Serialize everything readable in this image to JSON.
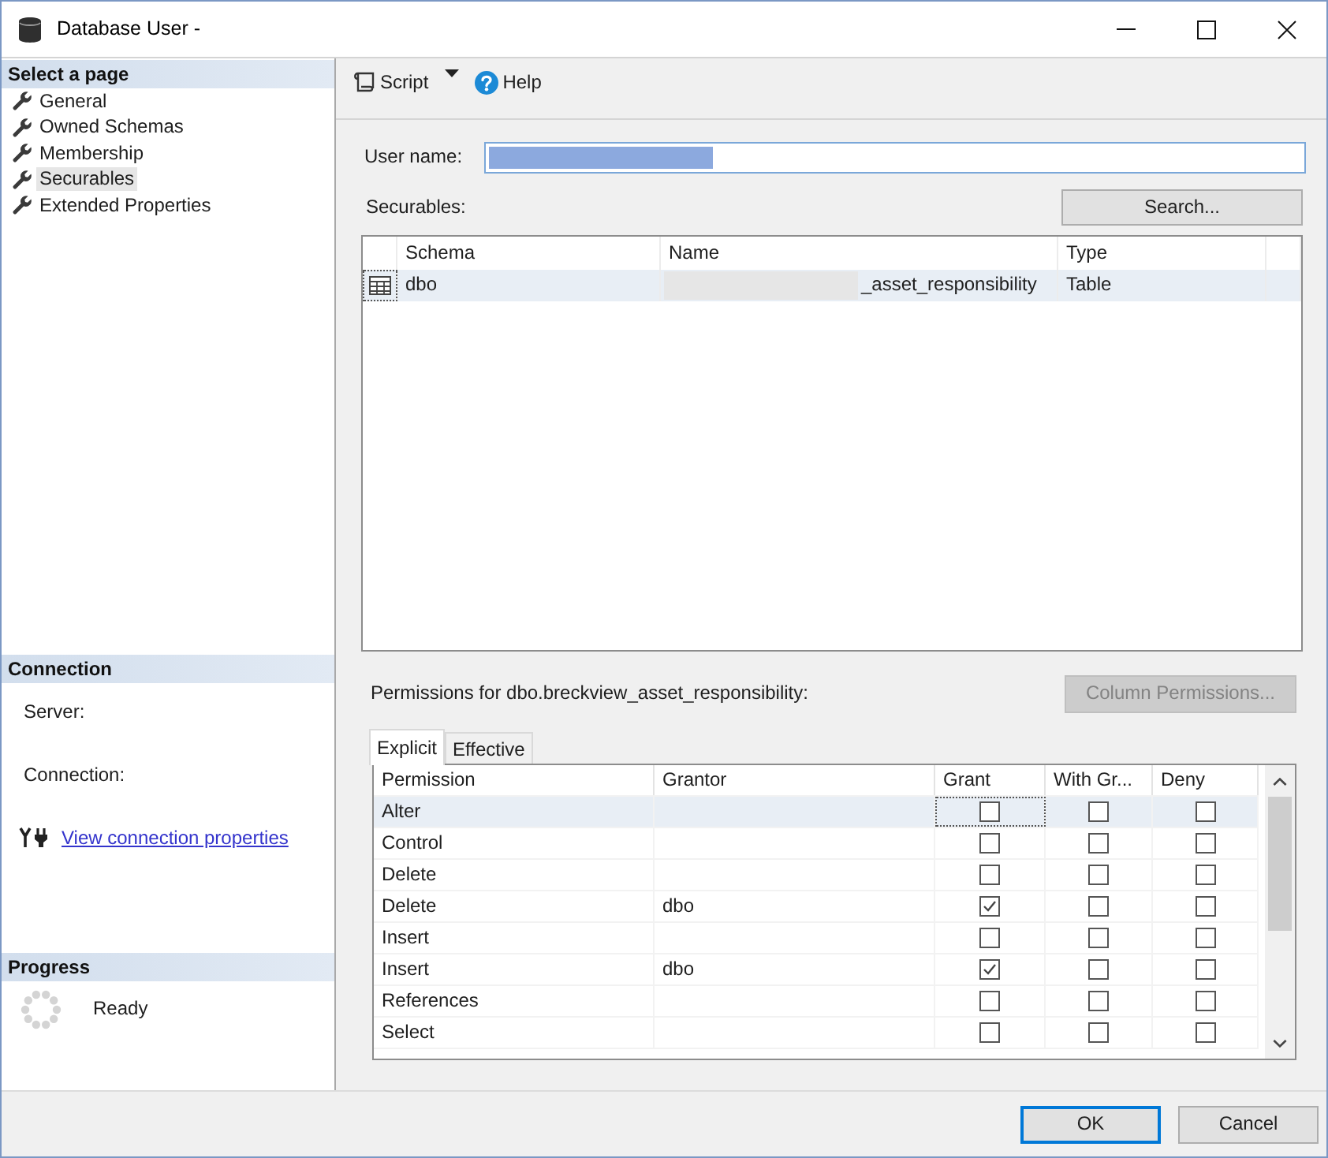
{
  "window": {
    "title": "Database User -"
  },
  "select_page": {
    "title": "Select a page",
    "items": [
      {
        "label": "General",
        "selected": false
      },
      {
        "label": "Owned Schemas",
        "selected": false
      },
      {
        "label": "Membership",
        "selected": false
      },
      {
        "label": "Securables",
        "selected": true
      },
      {
        "label": "Extended Properties",
        "selected": false
      }
    ]
  },
  "connection": {
    "title": "Connection",
    "fields": [
      "Server:",
      "Connection:"
    ],
    "link": "View connection properties"
  },
  "progress": {
    "title": "Progress",
    "status": "Ready"
  },
  "toolbar": {
    "script": "Script",
    "help": "Help"
  },
  "user_name": {
    "label": "User name:"
  },
  "securables": {
    "label": "Securables:",
    "search_button": "Search...",
    "columns": [
      "Schema",
      "Name",
      "Type"
    ],
    "rows": [
      {
        "schema": "dbo",
        "name": "_asset_responsibility",
        "type": "Table",
        "selected": true
      }
    ]
  },
  "permissions": {
    "label": "Permissions for dbo.breckview_asset_responsibility:",
    "column_permissions_button": {
      "label": "Column Permissions...",
      "disabled": true
    },
    "tabs": [
      {
        "label": "Explicit",
        "selected": true
      },
      {
        "label": "Effective",
        "selected": false
      }
    ],
    "columns": [
      "Permission",
      "Grantor",
      "Grant",
      "With Gr...",
      "Deny"
    ],
    "rows": [
      {
        "permission": "Alter",
        "grant": false,
        "with_grant": false,
        "deny": false,
        "selected": true
      },
      {
        "permission": "Control",
        "grant": false,
        "with_grant": false,
        "deny": false,
        "selected": false
      },
      {
        "permission": "Delete",
        "grant": false,
        "with_grant": false,
        "deny": false,
        "selected": false
      },
      {
        "permission": "Delete",
        "grantor": "dbo",
        "grant": true,
        "with_grant": false,
        "deny": false,
        "selected": false
      },
      {
        "permission": "Insert",
        "grant": false,
        "with_grant": false,
        "deny": false,
        "selected": false
      },
      {
        "permission": "Insert",
        "grantor": "dbo",
        "grant": true,
        "with_grant": false,
        "deny": false,
        "selected": false
      },
      {
        "permission": "References",
        "grant": false,
        "with_grant": false,
        "deny": false,
        "selected": false
      },
      {
        "permission": "Select",
        "grant": false,
        "with_grant": false,
        "deny": false,
        "selected": false
      }
    ]
  },
  "buttons": [
    {
      "label": "OK",
      "default": true
    },
    {
      "label": "Cancel",
      "default": false
    }
  ]
}
